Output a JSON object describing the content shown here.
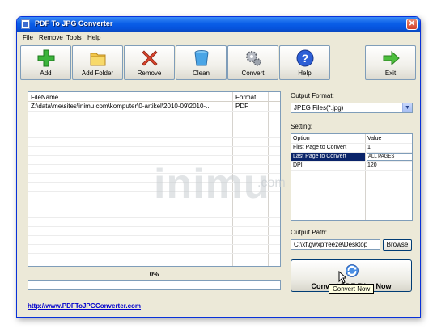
{
  "window": {
    "title": "PDF To JPG Converter",
    "close_glyph": "✕"
  },
  "menu": [
    "File",
    "Remove",
    "Tools",
    "Help"
  ],
  "toolbar": [
    {
      "label": "Add",
      "icon": "plus-icon"
    },
    {
      "label": "Add Folder",
      "icon": "folder-icon"
    },
    {
      "label": "Remove",
      "icon": "remove-icon"
    },
    {
      "label": "Clean",
      "icon": "bucket-icon"
    },
    {
      "label": "Convert",
      "icon": "gears-icon"
    },
    {
      "label": "Help",
      "icon": "help-icon"
    },
    {
      "label": "Exit",
      "icon": "exit-arrow-icon"
    }
  ],
  "file_list": {
    "columns": [
      "FileName",
      "Format"
    ],
    "rows": [
      {
        "filename": "Z:\\data\\me\\sites\\inimu.com\\komputer\\0-artikel\\2010-09\\2010-...",
        "format": "PDF"
      }
    ]
  },
  "progress": {
    "text": "0%",
    "value": 0
  },
  "link": "http://www.PDFToJPGConverter.com",
  "output_format": {
    "label": "Output Format:",
    "value": "JPEG Files(*.jpg)"
  },
  "setting": {
    "label": "Setting:",
    "columns": [
      "Option",
      "Value"
    ],
    "rows": [
      {
        "option": "First Page to Convert",
        "value": "1"
      },
      {
        "option": "Last Page to Convert",
        "value": "ALL PAGES"
      },
      {
        "option": "DPI",
        "value": "120"
      }
    ]
  },
  "output_path": {
    "label": "Output Path:",
    "value": "C:\\xf\\gwxpfreeze\\Desktop",
    "browse": "Browse"
  },
  "convert_button": "Convert PDF Files Now",
  "tooltip": "Convert Now",
  "watermark": {
    "main": "inimu",
    "suffix": ".com"
  },
  "colors": {
    "title_bar": "#0a5fe8",
    "window_bg": "#ece9d8",
    "selection": "#0a246a",
    "link": "#0000cc"
  }
}
